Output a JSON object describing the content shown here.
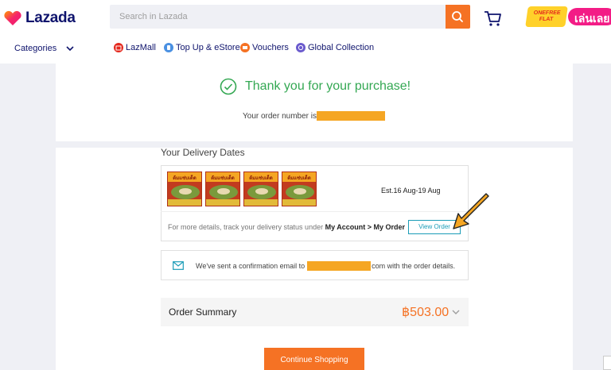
{
  "header": {
    "logo_text": "Lazada",
    "search_placeholder": "Search in Lazada",
    "promo_badge": "ONEFREE FLAT",
    "promo_text": "เล่นเลย"
  },
  "nav": {
    "categories_label": "Categories",
    "items": [
      {
        "label": "LazMall",
        "icon": "lazmall-icon",
        "color": "#e4281d"
      },
      {
        "label": "Top Up & eStore",
        "icon": "topup-icon",
        "color": "#4a90e2"
      },
      {
        "label": "Vouchers",
        "icon": "voucher-icon",
        "color": "#f57224"
      },
      {
        "label": "Global Collection",
        "icon": "global-icon",
        "color": "#6a5acd"
      }
    ]
  },
  "confirmation": {
    "thank_you": "Thank you for your purchase!",
    "order_number_label": "Your order number is"
  },
  "delivery": {
    "title": "Your Delivery Dates",
    "product_label": "ต้มแซ่บเด็ด",
    "estimate": "Est.16 Aug-19 Aug",
    "track_text": "For more details, track your delivery status under",
    "track_path": "My Account > My Order",
    "view_order_label": "View Order"
  },
  "email": {
    "text_before": "We've sent a confirmation email to",
    "text_after": "com with the order details."
  },
  "summary": {
    "label": "Order Summary",
    "total": "฿503.00"
  },
  "continue_label": "Continue Shopping",
  "colors": {
    "brand_orange": "#f57224",
    "success_green": "#34a853",
    "link_blue": "#1a9cb7",
    "redaction": "#f5a623"
  }
}
